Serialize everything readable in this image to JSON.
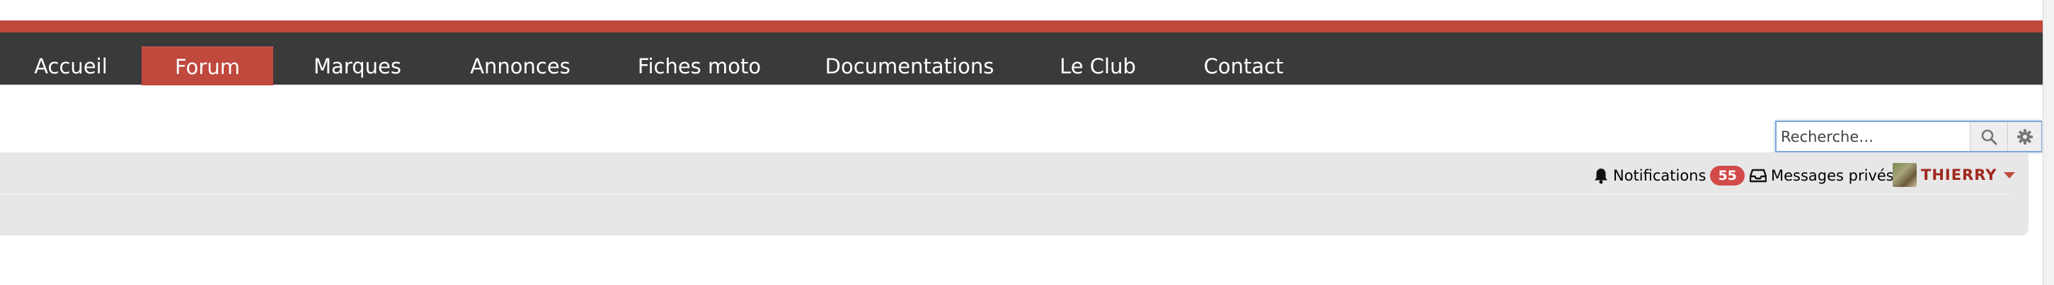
{
  "nav": {
    "items": [
      {
        "label": "Accueil",
        "active": false
      },
      {
        "label": "Forum",
        "active": true
      },
      {
        "label": "Marques",
        "active": false
      },
      {
        "label": "Annonces",
        "active": false
      },
      {
        "label": "Fiches moto",
        "active": false
      },
      {
        "label": "Documentations",
        "active": false
      },
      {
        "label": "Le Club",
        "active": false
      },
      {
        "label": "Contact",
        "active": false
      }
    ]
  },
  "search": {
    "placeholder": "Recherche…",
    "value": "",
    "button_icon": "search-icon",
    "settings_icon": "gear-icon"
  },
  "userbar": {
    "notifications_label": "Notifications",
    "notifications_count": "55",
    "notifications_icon": "bell-icon",
    "messages_label": "Messages privés",
    "messages_icon": "inbox-icon",
    "username": "THIERRY",
    "caret_icon": "caret-down-icon"
  },
  "colors": {
    "accent_red": "#c0483d",
    "nav_bg": "#3a3a3a",
    "panel_bg": "#e7e7e7",
    "badge_red": "#d24a4a",
    "username_color": "#a02820"
  }
}
